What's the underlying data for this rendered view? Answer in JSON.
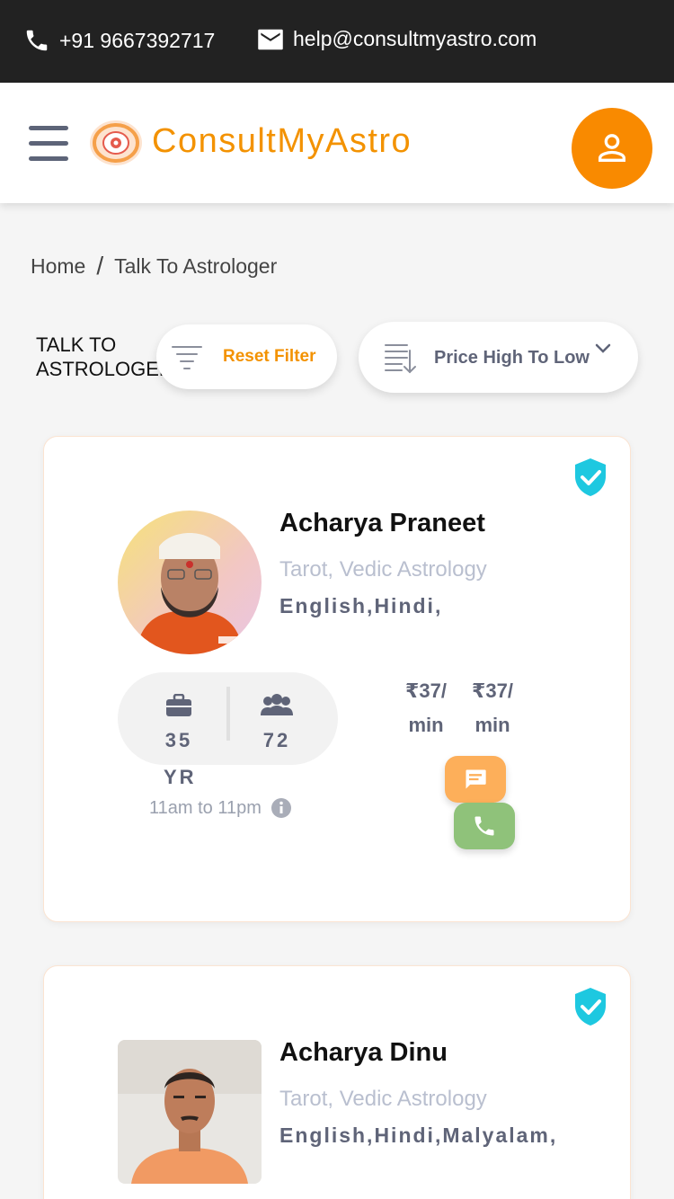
{
  "topbar": {
    "phone": "+91 9667392717",
    "email": "help@consultmyastro.com"
  },
  "header": {
    "brand": "ConsultMyAstro",
    "icons": [
      "menu-icon",
      "logo-icon",
      "user-icon"
    ]
  },
  "breadcrumb": {
    "home": "Home",
    "separator": "/",
    "current": "Talk To Astrologer"
  },
  "toolbar": {
    "section_title": "TALK TO ASTROLOGER",
    "reset_label": "Reset Filter",
    "sort_selected": "Price High To Low"
  },
  "astrologers": [
    {
      "name": "Acharya Praneet",
      "skills": "Tarot, Vedic Astrology",
      "languages": "English,Hindi,",
      "experience": "35",
      "experience_unit": "YR",
      "consultations": "72",
      "timing": "11am to 11pm",
      "chat_price": "₹37/ min",
      "call_price": "₹37/ min",
      "verified": true,
      "avatar_watermark": "ConsultMyAstro"
    },
    {
      "name": "Acharya Dinu",
      "skills": "Tarot, Vedic Astrology",
      "languages": "English,Hindi,Malyalam,",
      "verified": true
    }
  ],
  "colors": {
    "accent": "#f39200",
    "topbar": "#222222",
    "chat": "#fdaf5a",
    "call": "#8fc27a",
    "verified": "#1ec8e0"
  }
}
